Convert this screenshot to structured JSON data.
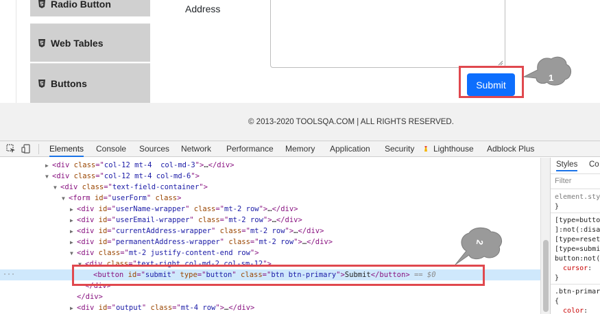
{
  "sidebar": {
    "items": [
      {
        "label": "Radio Button"
      },
      {
        "label": "Web Tables"
      },
      {
        "label": "Buttons"
      }
    ]
  },
  "form": {
    "address_label": "Address",
    "submit_label": "Submit"
  },
  "footer": {
    "copyright": "© 2013-2020 TOOLSQA.COM | ALL RIGHTS RESERVED."
  },
  "annotations": {
    "bubble_1": "1",
    "bubble_2": "2",
    "accent_color": "#e0484e"
  },
  "devtools": {
    "tabs": [
      "Elements",
      "Console",
      "Sources",
      "Network",
      "Performance",
      "Memory",
      "Application",
      "Security",
      "Lighthouse",
      "Adblock Plus"
    ],
    "active_tab": "Elements",
    "dom_lines": [
      {
        "indent": 0,
        "tri": "▶",
        "html": "<div class=\"col-12 mt-4  col-md-3\">…</div>"
      },
      {
        "indent": 0,
        "tri": "▼",
        "html": "<div class=\"col-12 mt-4 col-md-6\">"
      },
      {
        "indent": 1,
        "tri": "▼",
        "html": "<div class=\"text-field-container\">"
      },
      {
        "indent": 2,
        "tri": "▼",
        "html": "<form id=\"userForm\" class>"
      },
      {
        "indent": 3,
        "tri": "▶",
        "html": "<div id=\"userName-wrapper\" class=\"mt-2 row\">…</div>"
      },
      {
        "indent": 3,
        "tri": "▶",
        "html": "<div id=\"userEmail-wrapper\" class=\"mt-2 row\">…</div>"
      },
      {
        "indent": 3,
        "tri": "▶",
        "html": "<div id=\"currentAddress-wrapper\" class=\"mt-2 row\">…</div>"
      },
      {
        "indent": 3,
        "tri": "▶",
        "html": "<div id=\"permanentAddress-wrapper\" class=\"mt-2 row\">…</div>"
      },
      {
        "indent": 3,
        "tri": "▼",
        "html": "<div class=\"mt-2 justify-content-end row\">"
      },
      {
        "indent": 4,
        "tri": "▼",
        "html": "<div class=\"text-right col-md-2 col-sm-12\">"
      },
      {
        "indent": 5,
        "tri": "",
        "html": "<button id=\"submit\" type=\"button\" class=\"btn btn-primary\">Submit</button> == $0",
        "selected": true
      },
      {
        "indent": 4,
        "tri": "",
        "html": "</div>"
      },
      {
        "indent": 3,
        "tri": "",
        "html": "</div>"
      },
      {
        "indent": 3,
        "tri": "▶",
        "html": "<div id=\"output\" class=\"mt-4 row\">…</div>"
      }
    ],
    "selected_dots": "···",
    "styles": {
      "tabs": [
        "Styles",
        "Co"
      ],
      "filter_placeholder": "Filter",
      "lines": [
        "element.sty",
        "}",
        "[type=butto",
        "]:not(:disa",
        "[type=reset",
        "[type=submi",
        "button:not(",
        "  cursor:",
        "}",
        ".btn-primar",
        "{",
        "  color:"
      ]
    }
  }
}
